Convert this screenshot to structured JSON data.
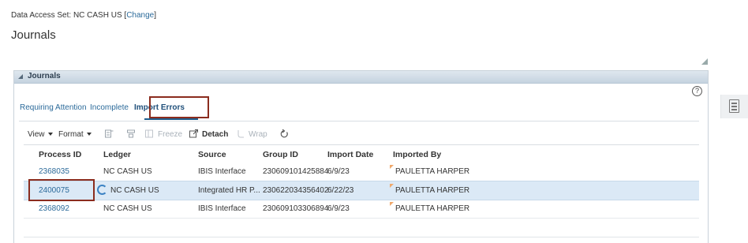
{
  "header": {
    "data_access_label": "Data Access Set:",
    "data_access_value": "NC CASH US",
    "change_link": "Change",
    "page_title": "Journals"
  },
  "panel": {
    "title": "Journals",
    "help": "?",
    "tabs": [
      {
        "label": "Requiring Attention"
      },
      {
        "label": "Incomplete"
      },
      {
        "label": "Import Errors",
        "active": true
      }
    ],
    "toolbar": {
      "view": "View",
      "format": "Format",
      "freeze": "Freeze",
      "detach": "Detach",
      "wrap": "Wrap"
    },
    "columns": [
      "Process ID",
      "Ledger",
      "Source",
      "Group ID",
      "Import Date",
      "Imported By"
    ],
    "rows": [
      {
        "process_id": "2368035",
        "ledger": "NC CASH US",
        "source": "IBIS Interface",
        "group_id": "230609101425884",
        "import_date": "6/9/23",
        "imported_by": "PAULETTA HARPER"
      },
      {
        "process_id": "2400075",
        "ledger": "NC CASH US",
        "source": "Integrated HR P...",
        "group_id": "230622034356402",
        "import_date": "6/22/23",
        "imported_by": "PAULETTA HARPER",
        "selected": true
      },
      {
        "process_id": "2368092",
        "ledger": "NC CASH US",
        "source": "IBIS Interface",
        "group_id": "230609103306894",
        "import_date": "6/9/23",
        "imported_by": "PAULETTA HARPER"
      }
    ]
  },
  "colors": {
    "link": "#2b6a9a",
    "highlight_box": "#8b2c1e",
    "selected_row": "#dbe9f6"
  },
  "icons": [
    "panel-collapse-icon",
    "help-icon",
    "query-by-example-icon",
    "filter-icon",
    "freeze-icon",
    "detach-icon",
    "wrap-icon",
    "refresh-icon",
    "loading-spinner-icon",
    "flag-icon",
    "document-icon",
    "resize-corner-icon"
  ]
}
